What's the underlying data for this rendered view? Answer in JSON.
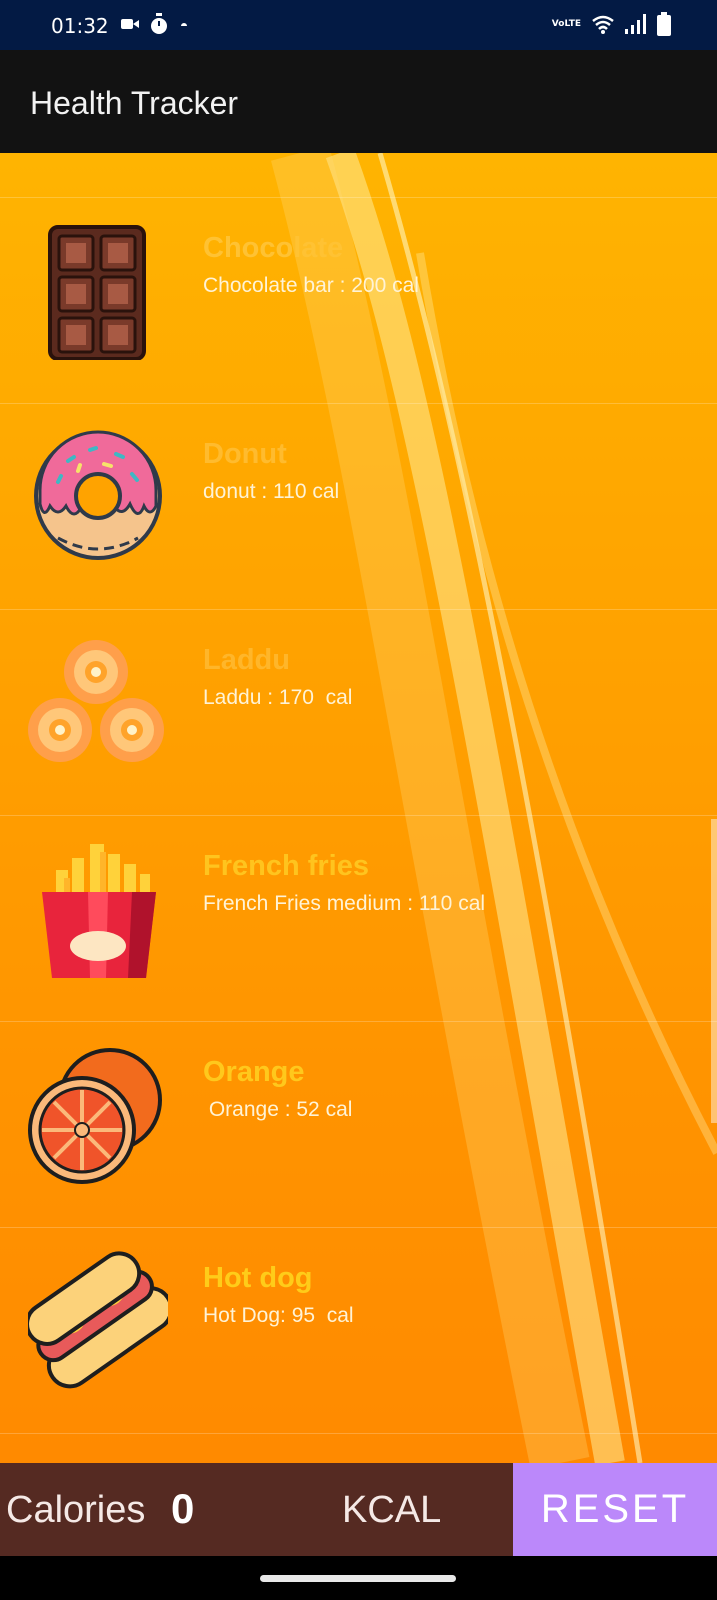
{
  "status_bar": {
    "time": "01:32",
    "network_label": "VoLTE",
    "left_icons": [
      "video-camera-icon",
      "stopwatch-icon",
      "dot-icon"
    ],
    "right_icons": [
      "volte-icon",
      "wifi-icon",
      "signal-icon",
      "battery-icon"
    ]
  },
  "app_bar": {
    "title": "Health Tracker"
  },
  "food_list": [
    {
      "title": "Chocolate",
      "desc": "Chocolate bar : 200 cal",
      "icon": "chocolate-icon",
      "title_color": "#ffc233"
    },
    {
      "title": "Donut",
      "desc": "donut : 110 cal",
      "icon": "donut-icon",
      "title_color": "#ffbb2e"
    },
    {
      "title": "Laddu",
      "desc": "Laddu : 170  cal",
      "icon": "laddu-icon",
      "title_color": "#ffb62a"
    },
    {
      "title": "French fries",
      "desc": "French Fries medium : 110 cal",
      "icon": "french-fries-icon",
      "title_color": "#ffc41e"
    },
    {
      "title": "Orange",
      "desc": " Orange : 52 cal",
      "icon": "orange-icon",
      "title_color": "#ffc81c"
    },
    {
      "title": "Hot dog",
      "desc": "Hot Dog: 95  cal",
      "icon": "hot-dog-icon",
      "title_color": "#ffcc19"
    }
  ],
  "bottom_bar": {
    "calories_label": "Calories",
    "calories_value": "0",
    "unit_label": "KCAL",
    "reset_label": "RESET"
  },
  "colors": {
    "status_bar": "#031a44",
    "app_bar": "#121212",
    "list_background": "#ffa300",
    "bottom_bar": "#552a22",
    "reset_button": "#bb88fa"
  }
}
